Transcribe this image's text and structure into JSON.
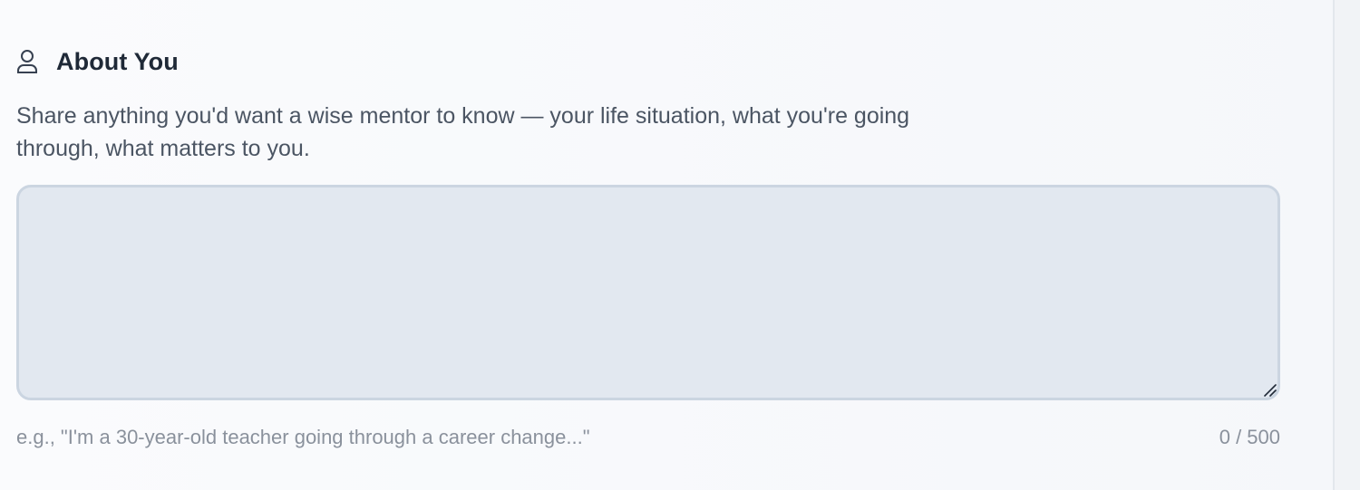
{
  "section": {
    "icon": "user-icon",
    "title": "About You",
    "description": "Share anything you'd want a wise mentor to know — your life situation, what you're going through, what matters to you."
  },
  "textarea": {
    "value": "",
    "hint": "e.g., \"I'm a 30-year-old teacher going through a career change...\"",
    "counter": "0 / 500"
  },
  "colors": {
    "title": "#1f2937",
    "text": "#4b5563",
    "muted": "#8a919c",
    "input_bg": "#e2e8f0",
    "input_border": "#cbd5e1"
  }
}
